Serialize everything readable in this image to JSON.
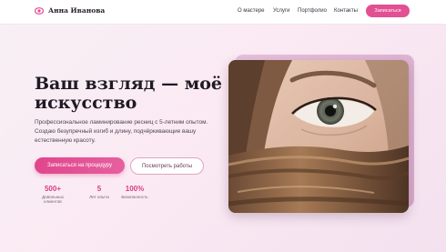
{
  "header": {
    "brand": "Анна Иванова",
    "nav": [
      "О мастере",
      "Услуги",
      "Портфолио",
      "Контакты"
    ],
    "cta": "Записаться"
  },
  "hero": {
    "title": "Ваш взгляд — моё искусство",
    "subtitle": "Профессиональное ламинирование ресниц с 5-летним опытом. Создаю безупречный изгиб и длину, подчёркивающие вашу естественную красоту.",
    "primary_button": "Записаться на процедуру",
    "secondary_button": "Посмотреть работы",
    "stats": [
      {
        "value": "500+",
        "label": "Довольных клиентов"
      },
      {
        "value": "5",
        "label": "Лет опыта"
      },
      {
        "value": "100%",
        "label": "Безопасность"
      }
    ]
  },
  "colors": {
    "accent": "#e24f93",
    "background": "#f8eef5",
    "text": "#2b2330"
  },
  "icons": {
    "logo": "eye-icon"
  }
}
